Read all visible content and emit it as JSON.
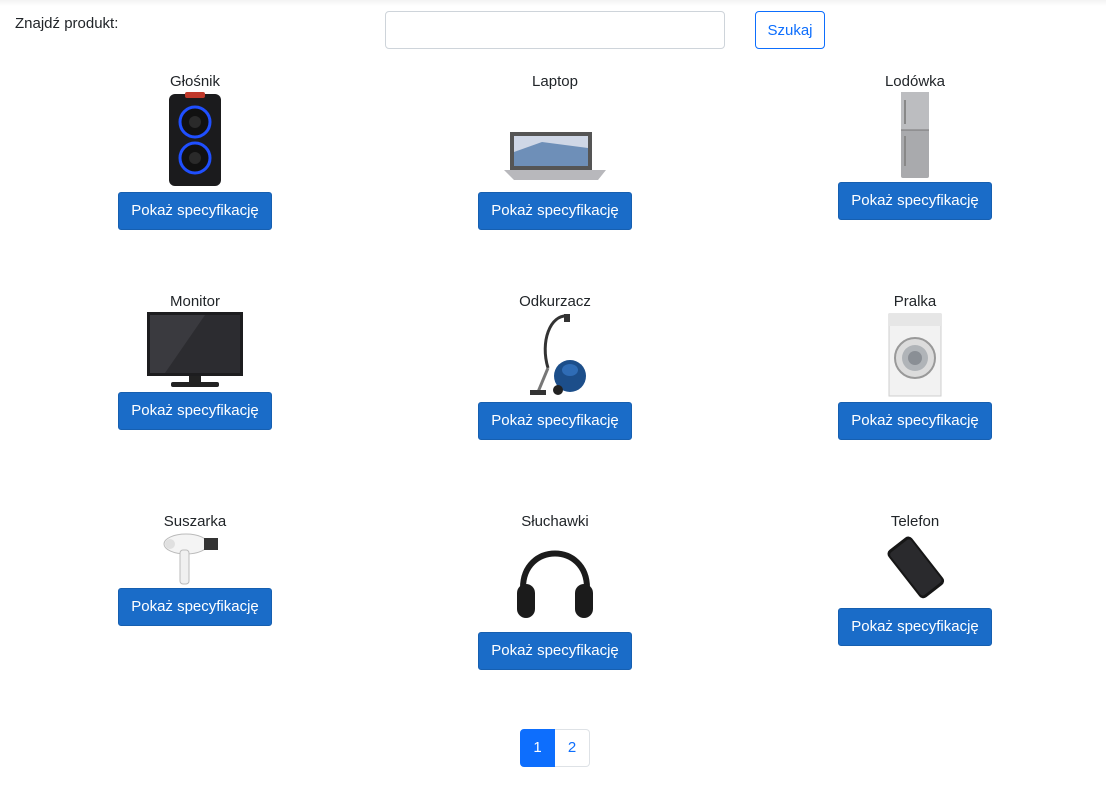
{
  "search": {
    "label": "Znajdź produkt:",
    "value": "",
    "placeholder": "",
    "button_label": "Szukaj"
  },
  "products": [
    {
      "name": "Głośnik",
      "icon": "speaker-image",
      "button_label": "Pokaż specyfikację"
    },
    {
      "name": "Laptop",
      "icon": "laptop-image",
      "button_label": "Pokaż specyfikację"
    },
    {
      "name": "Lodówka",
      "icon": "fridge-image",
      "button_label": "Pokaż specyfikację"
    },
    {
      "name": "Monitor",
      "icon": "monitor-image",
      "button_label": "Pokaż specyfikację"
    },
    {
      "name": "Odkurzacz",
      "icon": "vacuum-cleaner-image",
      "button_label": "Pokaż specyfikację"
    },
    {
      "name": "Pralka",
      "icon": "washing-machine-image",
      "button_label": "Pokaż specyfikację"
    },
    {
      "name": "Suszarka",
      "icon": "hair-dryer-image",
      "button_label": "Pokaż specyfikację"
    },
    {
      "name": "Słuchawki",
      "icon": "headphones-image",
      "button_label": "Pokaż specyfikację"
    },
    {
      "name": "Telefon",
      "icon": "phone-image",
      "button_label": "Pokaż specyfikację"
    }
  ],
  "pagination": {
    "pages": [
      "1",
      "2"
    ],
    "active": "1"
  },
  "colors": {
    "primary": "#0d6efd",
    "button": "#1a6cc8"
  }
}
